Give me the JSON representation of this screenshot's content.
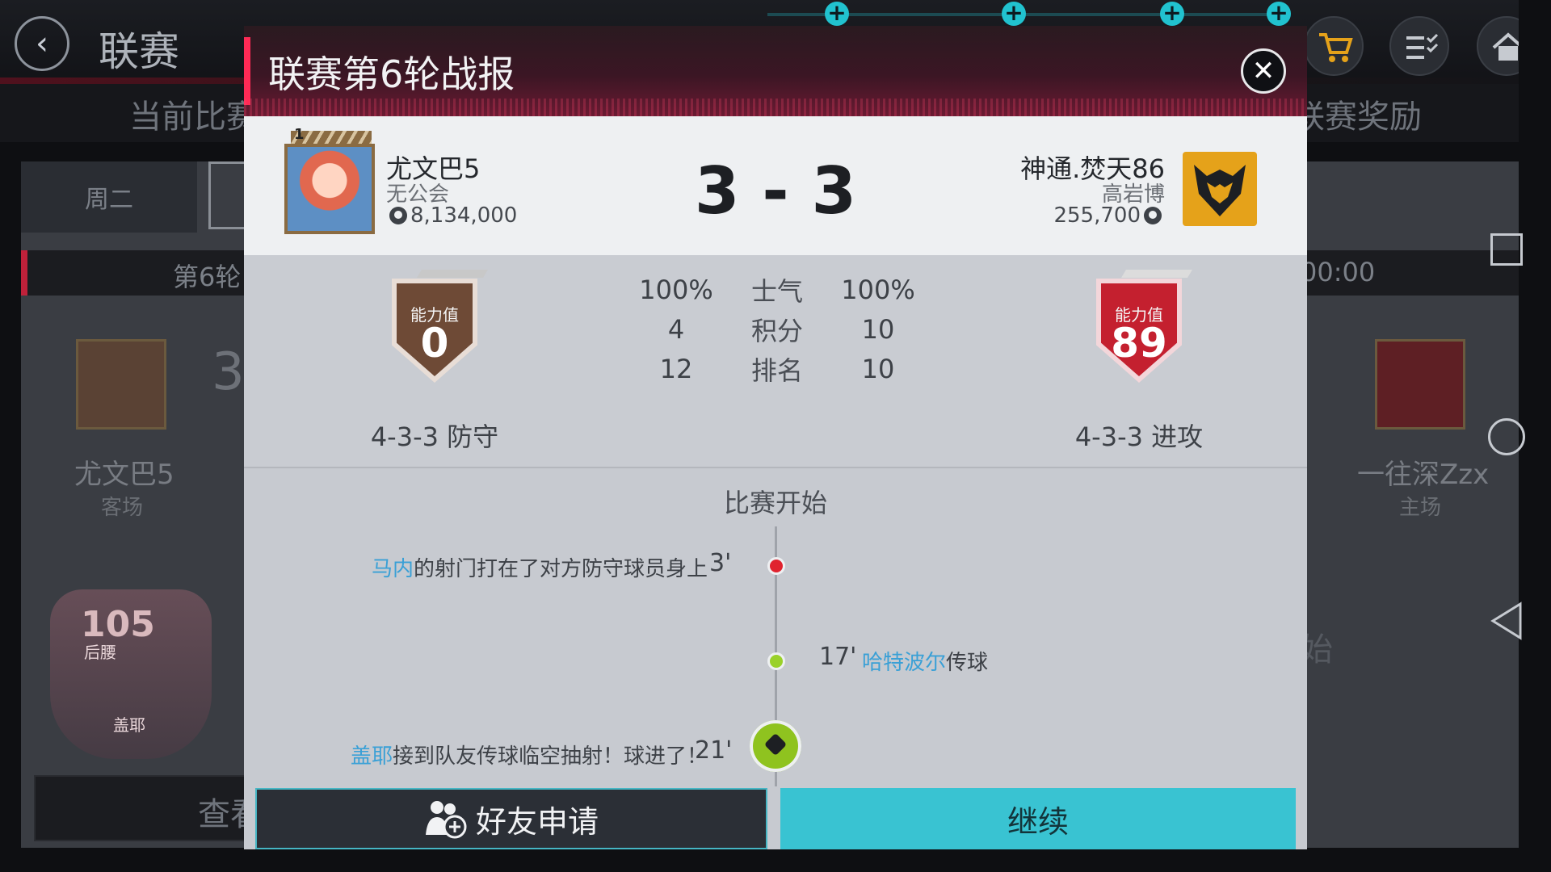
{
  "background": {
    "title": "联赛",
    "tab_left": "当前比赛",
    "tab_right": "联赛奖励",
    "day_label": "周二",
    "round_label": "第6轮",
    "time_label": "00:00",
    "left_team_name": "尤文巴5",
    "left_team_side": "客场",
    "left_score": "3",
    "right_team_name": "一往深Zzx",
    "right_team_side": "主场",
    "player_rating": "105",
    "player_position": "后腰",
    "player_name": "盖耶",
    "check_button_label": "查看",
    "right_faded_text": "始"
  },
  "modal": {
    "title": "联赛第6轮战报",
    "home": {
      "rank": "1",
      "name": "尤文巴5",
      "club": "无公会",
      "coins": "8,134,000",
      "badge_label": "能力值",
      "badge_value": "0",
      "formation": "4-3-3 防守"
    },
    "away": {
      "name": "神通.焚天86",
      "club": "高岩博",
      "coins": "255,700",
      "badge_label": "能力值",
      "badge_value": "89",
      "formation": "4-3-3 进攻"
    },
    "score": "3 - 3",
    "stats": [
      {
        "home": "100%",
        "label": "士气",
        "away": "100%"
      },
      {
        "home": "4",
        "label": "积分",
        "away": "10"
      },
      {
        "home": "12",
        "label": "排名",
        "away": "10"
      }
    ],
    "timeline": {
      "title": "比赛开始",
      "events": [
        {
          "player": "马内",
          "text": "的射门打在了对方防守球员身上",
          "minute": "3'"
        },
        {
          "player": "哈特波尔",
          "text": "传球",
          "minute": "17'"
        },
        {
          "player": "盖耶",
          "text": "接到队友传球临空抽射！球进了！",
          "minute": "21'"
        }
      ]
    },
    "buttons": {
      "friend_request": "好友申请",
      "continue": "继续"
    }
  },
  "colors": {
    "accent_red": "#ff2a55",
    "teal": "#39c3d2",
    "link_blue": "#3aa0d6",
    "home_badge": "#6e4a36",
    "away_badge": "#c4202f"
  }
}
